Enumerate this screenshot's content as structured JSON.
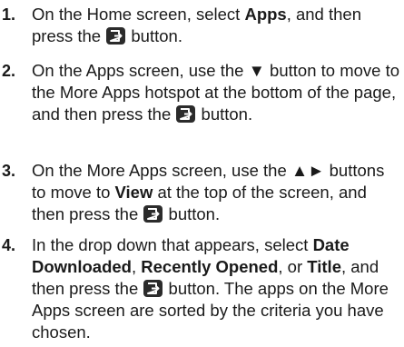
{
  "steps": [
    {
      "number": "1.",
      "segments": [
        {
          "t": "On the Home screen, select ",
          "b": false
        },
        {
          "t": "Apps",
          "b": true
        },
        {
          "t": ", and then press the ",
          "b": false
        },
        {
          "icon": "enter-button-icon"
        },
        {
          "t": " button.",
          "b": false
        }
      ]
    },
    {
      "number": "2.",
      "segments": [
        {
          "t": "On the Apps screen, use the ▼ button to move to the More Apps hotspot at the bottom of the page, and then press the ",
          "b": false
        },
        {
          "icon": "enter-button-icon"
        },
        {
          "t": " button.",
          "b": false
        }
      ]
    },
    {
      "number": "3.",
      "segments": [
        {
          "t": "On the More Apps screen, use the ▲► buttons to move to ",
          "b": false
        },
        {
          "t": "View",
          "b": true
        },
        {
          "t": " at the top of the screen, and then press the ",
          "b": false
        },
        {
          "icon": "enter-button-icon"
        },
        {
          "t": " button.",
          "b": false
        }
      ]
    },
    {
      "number": "4.",
      "segments": [
        {
          "t": "In the drop down that appears, select ",
          "b": false
        },
        {
          "t": "Date Downloaded",
          "b": true
        },
        {
          "t": ", ",
          "b": false
        },
        {
          "t": "Recently Opened",
          "b": true
        },
        {
          "t": ", or ",
          "b": false
        },
        {
          "t": "Title",
          "b": true
        },
        {
          "t": ", and then press the ",
          "b": false
        },
        {
          "icon": "enter-button-icon"
        },
        {
          "t": " button. The apps on the More Apps screen are sorted by the criteria you have chosen.",
          "b": false
        }
      ]
    }
  ]
}
